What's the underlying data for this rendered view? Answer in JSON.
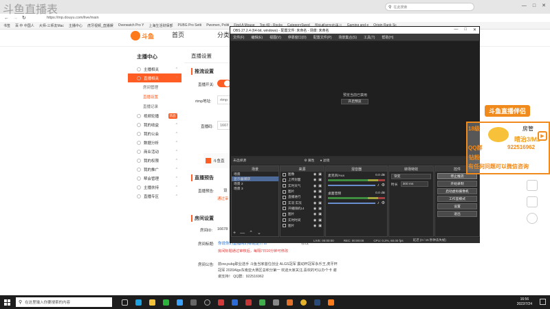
{
  "watermark": "斗鱼直播表",
  "browser": {
    "url": "https://mp.douyu.com/live/main",
    "search_placeholder": "在此搜索",
    "bookmarks": [
      "书签",
      "百 中 中国人",
      "大师-三师友Mac",
      "主播中心",
      "虎牙视频_直播娱",
      "Overwatch Pro Y",
      "上海生活财保部",
      "PUBG Pro Setti",
      "Pwomen, Politi",
      "Find A Mouse",
      "Top 40 - Rocks",
      "CategorySwed",
      "国外都可玩的事儿",
      "Gaming and e",
      "Origin Rank Sc"
    ]
  },
  "site": {
    "logo": "斗鱼",
    "nav": [
      "首页",
      "分类"
    ]
  },
  "sidebar": {
    "title": "主播中心",
    "items": [
      {
        "label": "主播相关",
        "type": "item"
      },
      {
        "label": "直播相关",
        "type": "item",
        "active": true
      },
      {
        "label": "房间管理",
        "type": "sub"
      },
      {
        "label": "直播设置",
        "type": "sub",
        "active": true
      },
      {
        "label": "直播记录",
        "type": "sub"
      },
      {
        "label": "视频轮播",
        "type": "item",
        "badge": "新品"
      },
      {
        "label": "我的收益",
        "type": "item"
      },
      {
        "label": "我的公会",
        "type": "item"
      },
      {
        "label": "数据分析",
        "type": "item"
      },
      {
        "label": "商业活动",
        "type": "item"
      },
      {
        "label": "我的权限",
        "type": "item"
      },
      {
        "label": "我的推广",
        "type": "item"
      },
      {
        "label": "帮会管理",
        "type": "item"
      },
      {
        "label": "主播扶持",
        "type": "item"
      },
      {
        "label": "直播专区",
        "type": "item"
      }
    ]
  },
  "main": {
    "page_title": "直播设置",
    "section1": "推流设置",
    "live_switch_label": "直播开关:",
    "rtmp_label": "rtmp地址:",
    "rtmp_value": "rtmp",
    "code_label": "直播码:",
    "code_value": "1667",
    "douyu_assistant": "斗鱼直",
    "section2": "直播预告",
    "preview_label": "直播预告:",
    "preview_value": "设",
    "notice_link": "通过审",
    "section3": "房间设置",
    "room_id_label": "房间ID:",
    "room_id_value": "16678",
    "room_title_label": "房间标题:",
    "room_title_value": "你说你的直播间的标题是什么",
    "room_title_edit": "修改",
    "room_title_tip": "房间标题通过审核后，每隔7日10分钟可修改",
    "announce_label": "房间公告:",
    "announce_text": "前ow,pubg职业选手 斗鱼当家首位创业 ALGS冠军 震动杯冠军永乐王,虎牙杯冠军 2020Algs东南亚大赛区总积分第一 欢迎大家关注,喜欢的可以办个卡 谢谢支持！  QQ群：922516962"
  },
  "obs": {
    "title": "OBS 27.2.4 (64-bit, windows) - 配置文件: 未命名 - 场景: 未命名",
    "menu": [
      "文件(F)",
      "编辑(E)",
      "视图(V)",
      "停靠窗口(D)",
      "配置文件(P)",
      "场景集合(S)",
      "工具(T)",
      "帮助(H)"
    ],
    "preview_msg": "预览当前已禁用",
    "preview_btn": "开启预览",
    "no_source": "未选择源",
    "props_btn": "属性",
    "filters_btn": "滤镜",
    "scenes_title": "场景",
    "scenes": [
      "场景",
      "显示器捕获",
      "场景 2",
      "场景 3"
    ],
    "sources_title": "来源",
    "sources": [
      "图像",
      "上传封面",
      "实时天气",
      "图片",
      "直播进行",
      "实况 实况",
      "开播随机14",
      "图片",
      "实时时间",
      "图片"
    ],
    "mixer_title": "混音器",
    "mixer": [
      {
        "name": "麦克风/Aux",
        "db": "0.0 dB"
      },
      {
        "name": "桌面音频",
        "db": "0.0 dB"
      }
    ],
    "transitions_title": "转场特效",
    "transition_type": "渐变",
    "duration_label": "时长",
    "duration_value": "300 ms",
    "controls_title": "控件",
    "controls": [
      "停止推流",
      "开始录制",
      "启动虚拟摄像机",
      "工作室模式",
      "设置",
      "退出"
    ],
    "status": {
      "live": "LIVE: 00:00:00",
      "rec": "REC: 00:00:00",
      "cpu": "CPU: 0.2%, 60.00 fps",
      "delay": "延迟 (0 / 15 秒钟丢失帧)"
    }
  },
  "promo": {
    "title": "斗鱼直播伴侣",
    "line1": "18级",
    "line2": "房管",
    "line3": "晴治3/Mz",
    "line4": "QQ群",
    "qq": "922516962",
    "line5": "钻粉",
    "line6": "有任何问题可以微信咨询"
  },
  "taskbar": {
    "search_placeholder": "在这里输入你要搜索的内容",
    "time": "16:56",
    "date": "2022/7/24"
  },
  "colors": {
    "accent": "#ff5d23",
    "obs_bg": "#2b2b2b",
    "promo_border": "#f08a1c"
  }
}
